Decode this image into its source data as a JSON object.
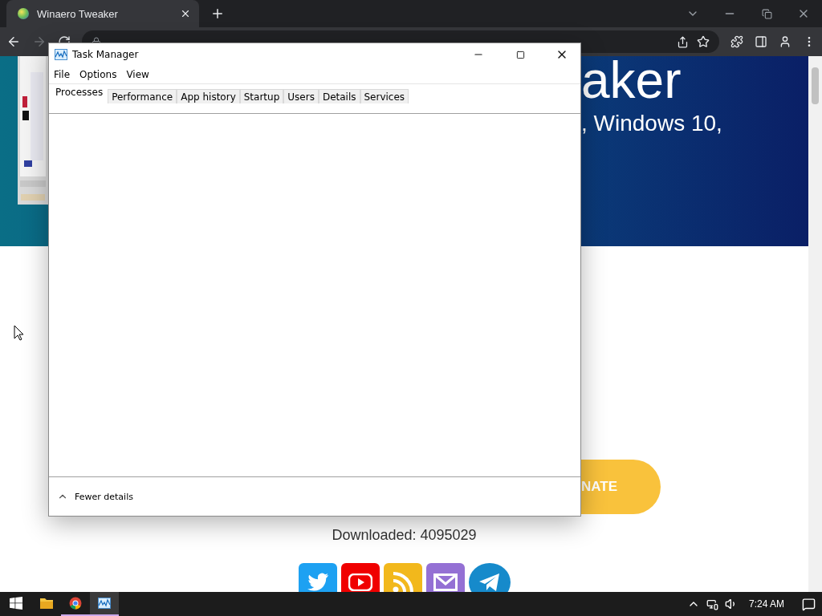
{
  "browser": {
    "tabs": [
      {
        "title": "Winaero Tweaker",
        "selected": true
      }
    ],
    "forward_disabled": true
  },
  "page": {
    "heading": "aker",
    "subheading": ", Windows 10,",
    "donate_button": "NATE",
    "downloads": "Downloaded: 4095029",
    "social": [
      {
        "kind": "twitter",
        "color": "#1da1f2"
      },
      {
        "kind": "youtube",
        "color": "#f00000"
      },
      {
        "kind": "rss",
        "color": "#f2b81c"
      },
      {
        "kind": "mail",
        "color": "#9470d4"
      },
      {
        "kind": "telegram",
        "color": "#168acb"
      }
    ]
  },
  "task_manager": {
    "title": "Task Manager",
    "menu": [
      "File",
      "Options",
      "View"
    ],
    "tabs": [
      {
        "label": "Processes",
        "selected": true
      },
      {
        "label": "Performance",
        "selected": false
      },
      {
        "label": "App history",
        "selected": false
      },
      {
        "label": "Startup",
        "selected": false
      },
      {
        "label": "Users",
        "selected": false
      },
      {
        "label": "Details",
        "selected": false
      },
      {
        "label": "Services",
        "selected": false
      }
    ],
    "footer": "Fewer details"
  },
  "taskbar": {
    "apps": [
      {
        "kind": "explorer",
        "running": false,
        "active": false
      },
      {
        "kind": "chrome",
        "running": true,
        "active": false
      },
      {
        "kind": "task-manager",
        "running": true,
        "active": true
      }
    ],
    "clock": "7:24 AM"
  }
}
